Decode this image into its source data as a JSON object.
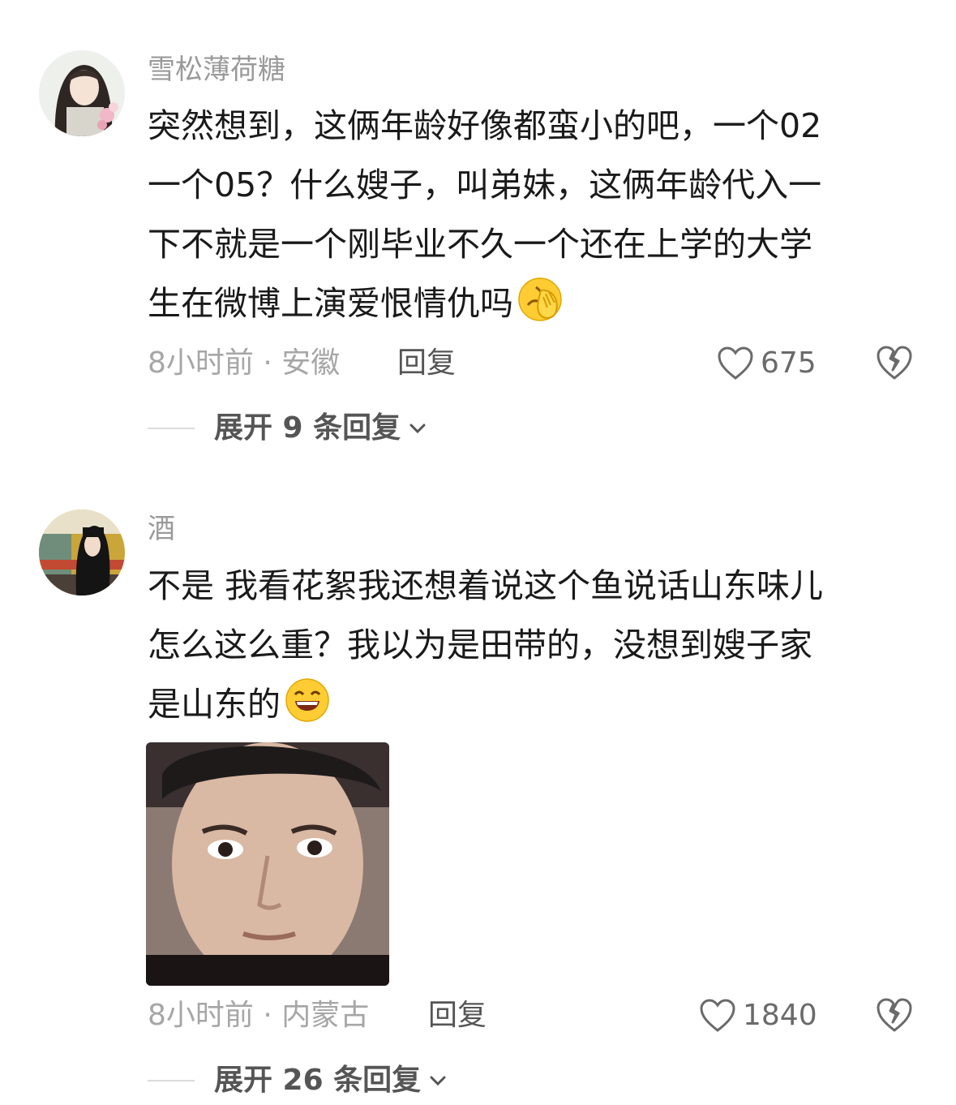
{
  "comments": [
    {
      "username": "雪松薄荷糖",
      "lines": [
        "突然想到，这俩年龄好像都蛮小的吧，一个02",
        "一个05？什么嫂子，叫弟妹，这俩年龄代入一",
        "下不就是一个刚毕业不久一个还在上学的大学",
        "生在微博上演爱恨情仇吗"
      ],
      "emoji": "face-with-hand-over-eyes-emoji",
      "meta": "8小时前 · 安徽",
      "reply_label": "回复",
      "likes": "675",
      "expand_label": "展开 9 条回复"
    },
    {
      "username": "酒",
      "lines": [
        "不是 我看花絮我还想着说这个鱼说话山东味儿",
        "怎么这么重？我以为是田带的，没想到嫂子家",
        "是山东的"
      ],
      "emoji": "grinning-squint-emoji",
      "meta": "8小时前 · 内蒙古",
      "reply_label": "回复",
      "likes": "1840",
      "expand_label": "展开 26 条回复"
    }
  ],
  "colors": {
    "username": "#9a9a9a",
    "text": "#1a1a1a",
    "meta": "#a6a6a6"
  }
}
